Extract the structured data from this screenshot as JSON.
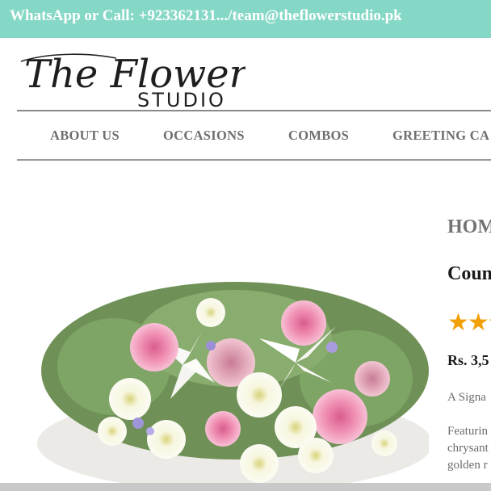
{
  "topbar": {
    "contact_text": "WhatsApp or Call: +923362131.../team@theflowerstudio.pk",
    "background": "#86d8c6"
  },
  "logo": {
    "script_text": "The Flower",
    "block_text": "STUDIO"
  },
  "nav": {
    "items": [
      {
        "label": "ABOUT US"
      },
      {
        "label": "OCCASIONS"
      },
      {
        "label": "COMBOS"
      },
      {
        "label": "GREETING CA"
      }
    ]
  },
  "product": {
    "breadcrumb": "HOM",
    "title": "Coun",
    "rating_stars": "★★★",
    "star_color": "#f2a007",
    "price": "Rs. 3,5",
    "description_short": "A Signa",
    "description_lines": [
      "Featurin",
      "chrysant",
      "golden r"
    ]
  }
}
